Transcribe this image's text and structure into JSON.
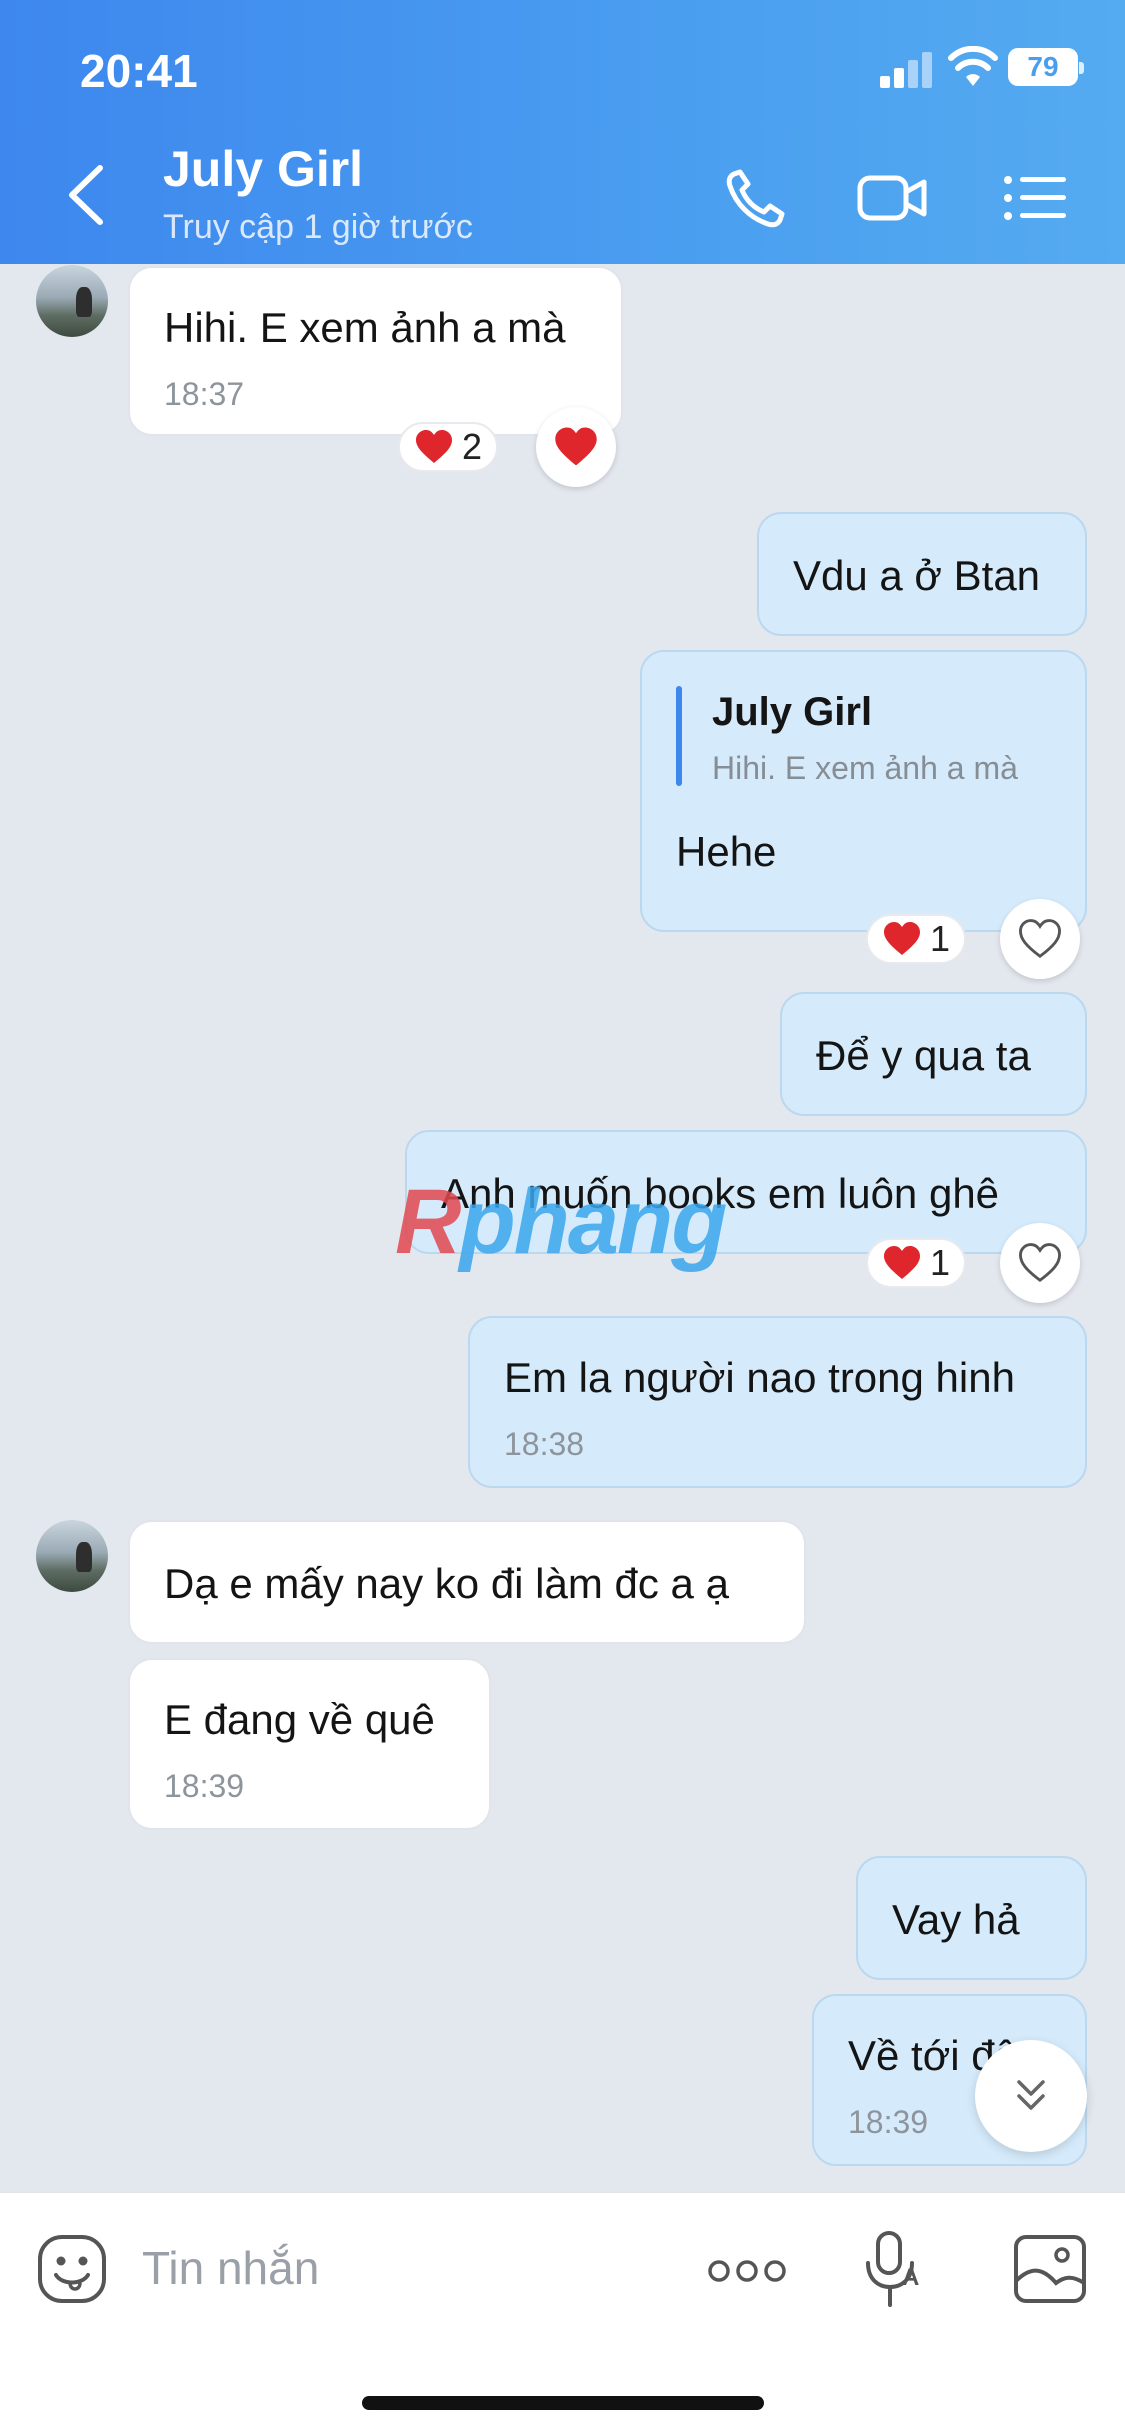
{
  "status_bar": {
    "time": "20:41",
    "battery": "79"
  },
  "header": {
    "contact_name": "July Girl",
    "contact_status": "Truy cập 1 giờ trước",
    "icons": [
      "back-chevron-icon",
      "phone-icon",
      "video-call-icon",
      "menu-list-icon"
    ]
  },
  "messages": [
    {
      "side": "in",
      "text": "Hihi. E xem ảnh a mà",
      "time": "18:37",
      "reaction_count": "2"
    },
    {
      "side": "out",
      "text": "Vdu a ở Btan"
    },
    {
      "side": "out",
      "reply_to_name": "July Girl",
      "reply_to_text": "Hihi. E xem ảnh a mà",
      "text": "Hehe",
      "reaction_count": "1"
    },
    {
      "side": "out",
      "text": "Để y qua ta"
    },
    {
      "side": "out",
      "text": "Anh muốn books em luôn ghê",
      "reaction_count": "1"
    },
    {
      "side": "out",
      "text": "Em la người nao trong hinh",
      "time": "18:38"
    },
    {
      "side": "in",
      "text": "Dạ e mấy nay ko đi làm đc a ạ"
    },
    {
      "side": "in",
      "text": "E đang về quê",
      "time": "18:39"
    },
    {
      "side": "out",
      "text": "Vay hả"
    },
    {
      "side": "out",
      "text": "Về tới đâ",
      "time": "18:39"
    }
  ],
  "watermark": {
    "r": "R",
    "rest": "phang"
  },
  "composer": {
    "placeholder": "Tin nhắn"
  },
  "colors": {
    "header_start": "#3d87ee",
    "header_end": "#55abf0",
    "outgoing_bubble": "#d5ebfb",
    "incoming_bubble": "#ffffff",
    "background": "#e3e7ee"
  }
}
